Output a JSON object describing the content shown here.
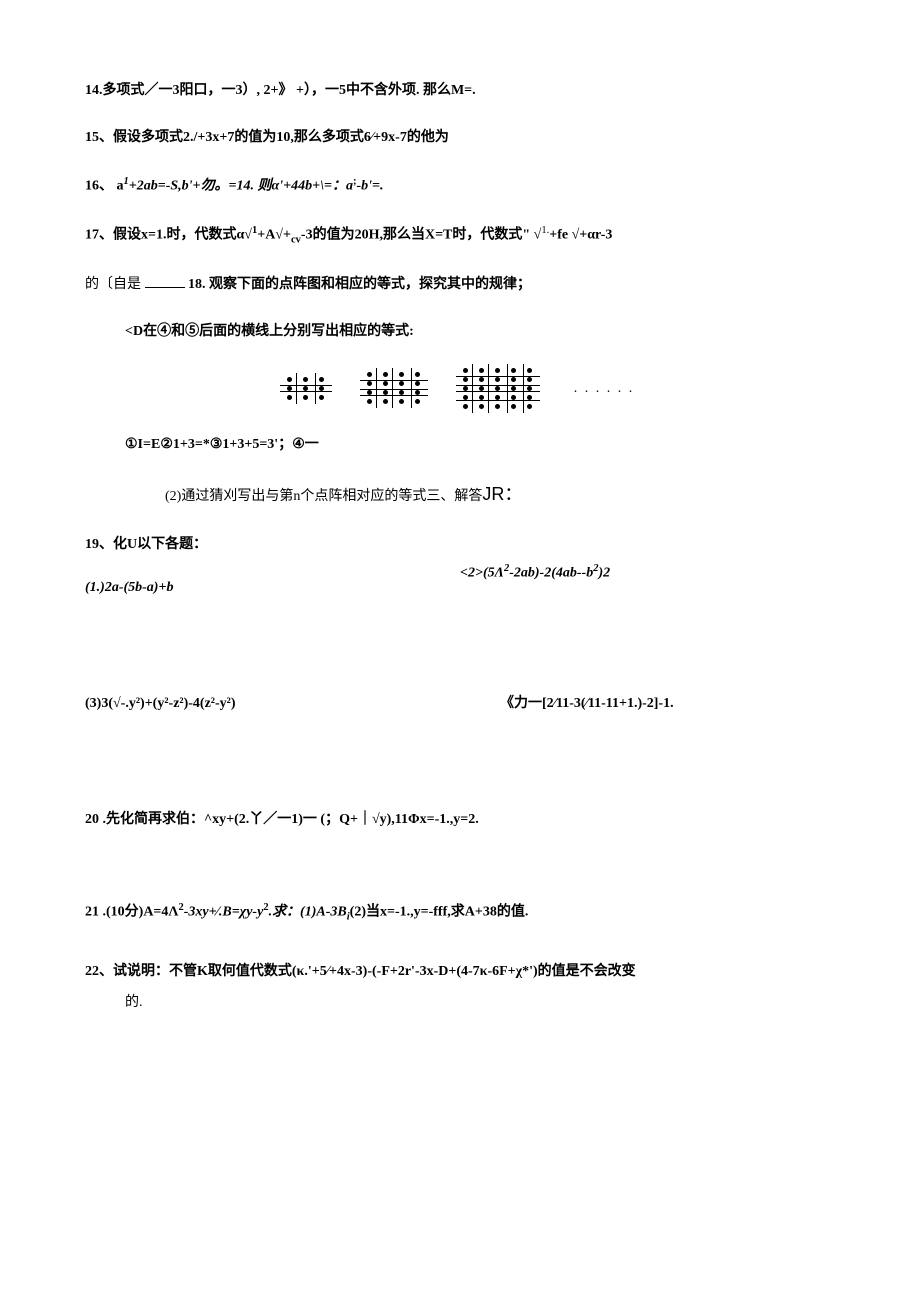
{
  "q14": "14.多项式／一3阳口，一3）,  2+》 +），一5中不含外项. 那么M=.",
  "q15": "15、假设多项式2./+3x+7的值为10,那么多项式6∕+9x-7的他为",
  "q16_a": "16、 a",
  "q16_b": "+2ab=-S,b'+勿。=14. 则α'+44b+\\=：a",
  "q16_c": "-b'=.",
  "q17a": "17、假设x=1.时，代数式α√",
  "q17b": "+A√+",
  "q17c": "-3的值为20H,那么当X=T时，代数式\" √",
  "q17d": "+fe √+αr-3",
  "q17e": "的〔自是",
  "q18a": "18. 观察下面的点阵图和相应的等式，探究其中的规律；",
  "q18b": "<D在④和⑤后面的横线上分别写出相应的等式:",
  "q18c": "①I=E②1+3=*③1+3+5=3'；④一",
  "q18d": "(2)通过猜刈写出与第n个点阵相对应的等式三、解答",
  "q18e": "JR：",
  "q19header": "19、化U以下各题：",
  "q19_1": "(1.)2a-(5b-a)+b",
  "q19_2_a": "<2>(5Λ",
  "q19_2_b": "-2ab)-2(4ab--b",
  "q19_2_c": ")2",
  "q19_3": "(3)3(√-.y²)+(y²-z²)-4(z²-y²)",
  "q19_4": "《力一[2∕11-3(∕11-11+1.)-2]-1.",
  "q20": "20   .先化简再求伯：^xy+(2.丫／一1)一 (；Q+｜√y),11Φx=-1.,y=2.",
  "q21_a": "21   .(10分)A=4Λ",
  "q21_b": "-3xy+∕.B=χy-y",
  "q21_c": ".求：(1)A-3B",
  "q21_d": "(2)当x=-1.,y=-fff,求A+38的值.",
  "q22a": "22、试说明：不管K取何值代数式(κ.'+5∕+4x-3)-(-F+2r'-3x-D+(4-7κ-6F+χ*')的值是不会改变",
  "q22b": "的.",
  "ellipsis": ". . . . . .",
  "sub_cv": "cv",
  "sup_1": "1",
  "sup_1dot": "1.",
  "sup_2": "2",
  "sup_semi": ";",
  "sub_i": "i"
}
